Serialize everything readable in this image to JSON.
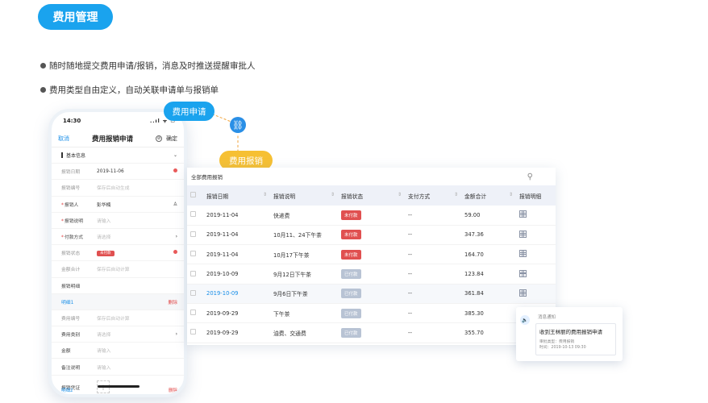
{
  "section_title": "费用管理",
  "bullets": [
    "随时随地提交费用申请/报销，消息及时推送提醒审批人",
    "费用类型自由定义，自动关联申请单与报销单"
  ],
  "bubbles": {
    "apply": "费用申请",
    "reimburse": "费用报销"
  },
  "phone": {
    "time": "14:30",
    "signal": "..ıl ᯤ ▭",
    "nav": {
      "cancel": "取消",
      "title": "费用报销申请",
      "confirm": "确定"
    },
    "basic_section": "基本信息",
    "fields": [
      {
        "label": "报销日期",
        "value": "2019-11-06"
      },
      {
        "label": "报销编号",
        "value": "保存后自动生成"
      },
      {
        "label": "报销人",
        "value": "彭华楠"
      },
      {
        "label": "报销说明",
        "value": "请输入"
      },
      {
        "label": "付款方式",
        "value": "请选择"
      },
      {
        "label": "报销状态",
        "value": "未付款"
      },
      {
        "label": "金额合计",
        "value": "保存后自动计算"
      },
      {
        "label": "报销明细",
        "value": ""
      }
    ],
    "detail1": {
      "label": "明细1",
      "delete": "删除"
    },
    "detail_fields": [
      {
        "label": "费用编号",
        "value": "保存后自动计算"
      },
      {
        "label": "费用类别",
        "value": "请选择"
      },
      {
        "label": "金额",
        "value": "请输入"
      },
      {
        "label": "备注说明",
        "value": "请输入"
      },
      {
        "label": "报销凭证",
        "value": "+"
      }
    ],
    "detail2": {
      "label": "明细2",
      "delete": "删除"
    }
  },
  "table": {
    "filter_label": "全部费用报销",
    "headers": [
      "报销日期",
      "报销说明",
      "报销状态",
      "支付方式",
      "金额合计",
      "报销明细"
    ],
    "rows": [
      {
        "date": "2019-11-04",
        "desc": "快递费",
        "status": "未付款",
        "paid": false,
        "pay": "--",
        "amount": "59.00"
      },
      {
        "date": "2019-11-04",
        "desc": "10月11、24下午茶",
        "status": "未付款",
        "paid": false,
        "pay": "--",
        "amount": "347.36"
      },
      {
        "date": "2019-11-04",
        "desc": "10月17下午茶",
        "status": "未付款",
        "paid": false,
        "pay": "--",
        "amount": "164.70"
      },
      {
        "date": "2019-10-09",
        "desc": "9月12日下午茶",
        "status": "已付款",
        "paid": true,
        "pay": "--",
        "amount": "123.84"
      },
      {
        "date": "2019-10-09",
        "desc": "9月6日下午茶",
        "status": "已付款",
        "paid": true,
        "pay": "--",
        "amount": "361.84"
      },
      {
        "date": "2019-09-29",
        "desc": "下午茶",
        "status": "已付款",
        "paid": true,
        "pay": "--",
        "amount": "385.30"
      },
      {
        "date": "2019-09-29",
        "desc": "油费、交通费",
        "status": "已付款",
        "paid": true,
        "pay": "--",
        "amount": "355.70"
      }
    ]
  },
  "notification": {
    "caption": "消息通知",
    "title": "收到王林丽的费用报销申请",
    "line1": "审批类型：费用报销",
    "line2": "时间：2019-10-13  09:30"
  },
  "colors": {
    "brand_blue": "#1aa3ee",
    "accent_yellow": "#f6c033",
    "unpaid_red": "#e05050",
    "paid_gray": "#b8c3d4"
  }
}
